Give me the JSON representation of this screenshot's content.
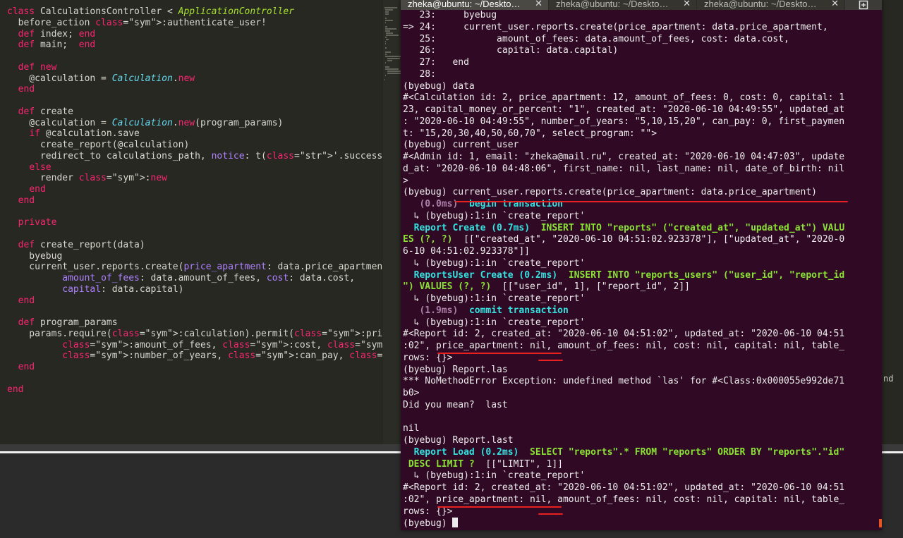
{
  "editor": {
    "lines": [
      {
        "t": "class CalculationsController < ApplicationController"
      },
      {
        "t": "  before_action :authenticate_user!"
      },
      {
        "t": "  def index; end"
      },
      {
        "t": "  def main;  end"
      },
      {
        "t": ""
      },
      {
        "t": "  def new"
      },
      {
        "t": "    @calculation = Calculation.new"
      },
      {
        "t": "  end"
      },
      {
        "t": ""
      },
      {
        "t": "  def create"
      },
      {
        "t": "    @calculation = Calculation.new(program_params)"
      },
      {
        "t": "    if @calculation.save"
      },
      {
        "t": "      create_report(@calculation)"
      },
      {
        "t": "      redirect_to calculations_path, notice: t('.success')"
      },
      {
        "t": "    else"
      },
      {
        "t": "      render :new"
      },
      {
        "t": "    end"
      },
      {
        "t": "  end"
      },
      {
        "t": ""
      },
      {
        "t": "  private"
      },
      {
        "t": ""
      },
      {
        "t": "  def create_report(data)"
      },
      {
        "t": "    byebug"
      },
      {
        "t": "    current_user.reports.create(price_apartment: data.price_apartment,"
      },
      {
        "t": "          amount_of_fees: data.amount_of_fees, cost: data.cost,"
      },
      {
        "t": "          capital: data.capital)"
      },
      {
        "t": "  end"
      },
      {
        "t": ""
      },
      {
        "t": "  def program_params"
      },
      {
        "t": "    params.require(:calculation).permit(:price_apartment,"
      },
      {
        "t": "          :amount_of_fees, :cost, :capital, :capital_money_or_percent,"
      },
      {
        "t": "          :number_of_years, :can_pay, :first_payment, :select_program)"
      },
      {
        "t": "  end"
      },
      {
        "t": ""
      },
      {
        "t": "end"
      }
    ],
    "right_fragment": "nd"
  },
  "terminal": {
    "tabs": [
      {
        "label": "zheka@ubuntu: ~/Deskto…",
        "active": true
      },
      {
        "label": "zheka@ubuntu: ~/Deskto…",
        "active": false
      },
      {
        "label": "zheka@ubuntu: ~/Deskto…",
        "active": false
      }
    ],
    "lines": [
      "   23:     byebug",
      "=> 24:     current_user.reports.create(price_apartment: data.price_apartment,",
      "   25:           amount_of_fees: data.amount_of_fees, cost: data.cost,",
      "   26:           capital: data.capital)",
      "   27:   end",
      "   28: ",
      "(byebug) data",
      "#<Calculation id: 2, price_apartment: 12, amount_of_fees: 0, cost: 0, capital: 1",
      "23, capital_money_or_percent: \"1\", created_at: \"2020-06-10 04:49:55\", updated_at",
      ": \"2020-06-10 04:49:55\", number_of_years: \"5,10,15,20\", can_pay: 0, first_paymen",
      "t: \"15,20,30,40,50,60,70\", select_program: \"\">",
      "(byebug) current_user",
      "#<Admin id: 1, email: \"zheka@mail.ru\", created_at: \"2020-06-10 04:47:03\", update",
      "d_at: \"2020-06-10 04:48:06\", first_name: nil, last_name: nil, date_of_birth: nil",
      ">",
      "(byebug) current_user.reports.create(price_apartment: data.price_apartment)",
      "   (0.0ms)  begin transaction",
      "  ↳ (byebug):1:in `create_report'",
      "  Report Create (0.7ms)  INSERT INTO \"reports\" (\"created_at\", \"updated_at\") VALU",
      "ES (?, ?)  [[\"created_at\", \"2020-06-10 04:51:02.923378\"], [\"updated_at\", \"2020-0",
      "6-10 04:51:02.923378\"]]",
      "  ↳ (byebug):1:in `create_report'",
      "  ReportsUser Create (0.2ms)  INSERT INTO \"reports_users\" (\"user_id\", \"report_id",
      "\") VALUES (?, ?)  [[\"user_id\", 1], [\"report_id\", 2]]",
      "  ↳ (byebug):1:in `create_report'",
      "   (1.9ms)  commit transaction",
      "  ↳ (byebug):1:in `create_report'",
      "#<Report id: 2, created_at: \"2020-06-10 04:51:02\", updated_at: \"2020-06-10 04:51",
      ":02\", price_apartment: nil, amount_of_fees: nil, cost: nil, capital: nil, table_",
      "rows: {}>",
      "(byebug) Report.las",
      "*** NoMethodError Exception: undefined method `las' for #<Class:0x000055e992de71",
      "b0>",
      "Did you mean?  last",
      "",
      "nil",
      "(byebug) Report.last",
      "  Report Load (0.2ms)  SELECT \"reports\".* FROM \"reports\" ORDER BY \"reports\".\"id\"",
      " DESC LIMIT ?  [[\"LIMIT\", 1]]",
      "  ↳ (byebug):1:in `create_report'",
      "#<Report id: 2, created_at: \"2020-06-10 04:51:02\", updated_at: \"2020-06-10 04:51",
      ":02\", price_apartment: nil, amount_of_fees: nil, cost: nil, capital: nil, table_",
      "rows: {}>",
      "(byebug) "
    ]
  },
  "colors": {
    "editor_bg": "#272822",
    "terminal_bg": "#300a24",
    "annotation": "#e8201f"
  }
}
